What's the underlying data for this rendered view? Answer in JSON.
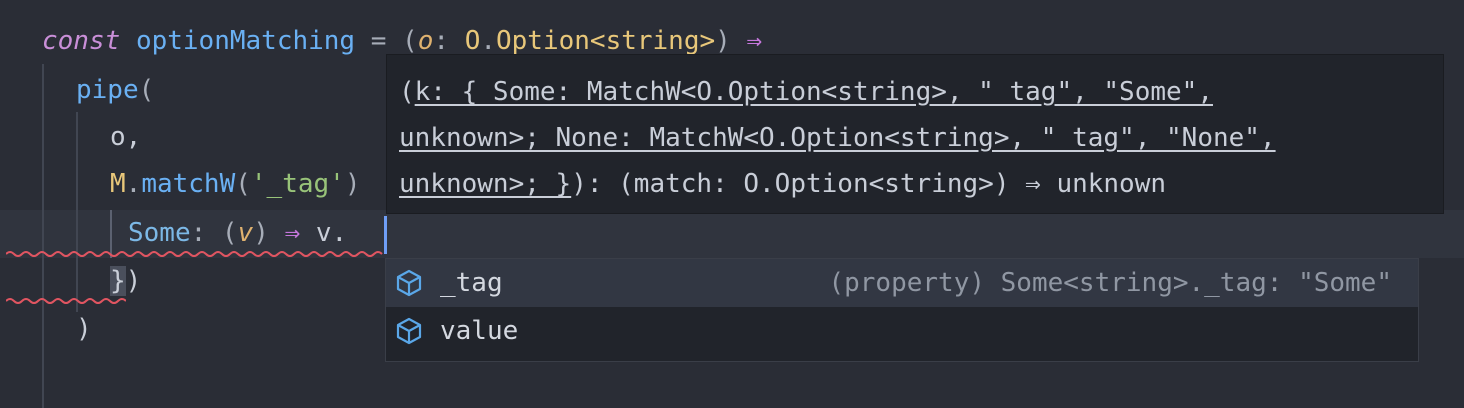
{
  "code": {
    "line1": {
      "kw": "const",
      "name": "optionMatching",
      "eq": " = (",
      "param": "o",
      "colon": ": ",
      "ns": "O",
      "dot": ".",
      "type": "Option<string>",
      "close": ") ",
      "arrow": "⇒"
    },
    "line2": {
      "fn": "pipe",
      "paren": "("
    },
    "line3": {
      "text": "o,"
    },
    "line4": {
      "ns": "M",
      "dot": ".",
      "fn": "matchW",
      "open": "(",
      "str": "'_tag'",
      "close": ")"
    },
    "line5": {
      "key": "Some",
      "colon": ": (",
      "param": "v",
      "close": ") ",
      "arrow": "⇒",
      "tail": " v."
    },
    "line6": {
      "brace": "}",
      "paren": ")"
    },
    "line7": {
      "paren": ")"
    }
  },
  "hover": {
    "row1_a": "(",
    "row1_b": "k: { Some: MatchW<O.Option<string>, \"_tag\", \"Some\",",
    "row2_b": "unknown>; None: MatchW<O.Option<string>, \"_tag\", \"None\",",
    "row3_b": "unknown>; }",
    "row3_c": "): (match: O.Option<string>) ⇒ unknown"
  },
  "suggest": {
    "items": [
      {
        "icon": "property-cube-icon",
        "label": "_tag",
        "detail": "(property) Some<string>._tag: \"Some\""
      },
      {
        "icon": "property-cube-icon",
        "label": "value",
        "detail": ""
      }
    ]
  },
  "colors": {
    "background": "#2a2d36",
    "keyword": "#c98fd8",
    "function": "#6ab0f3",
    "string": "#98c379",
    "type": "#e8c77a",
    "error_squiggle": "#e05561",
    "cursor": "#6f9ef5"
  }
}
